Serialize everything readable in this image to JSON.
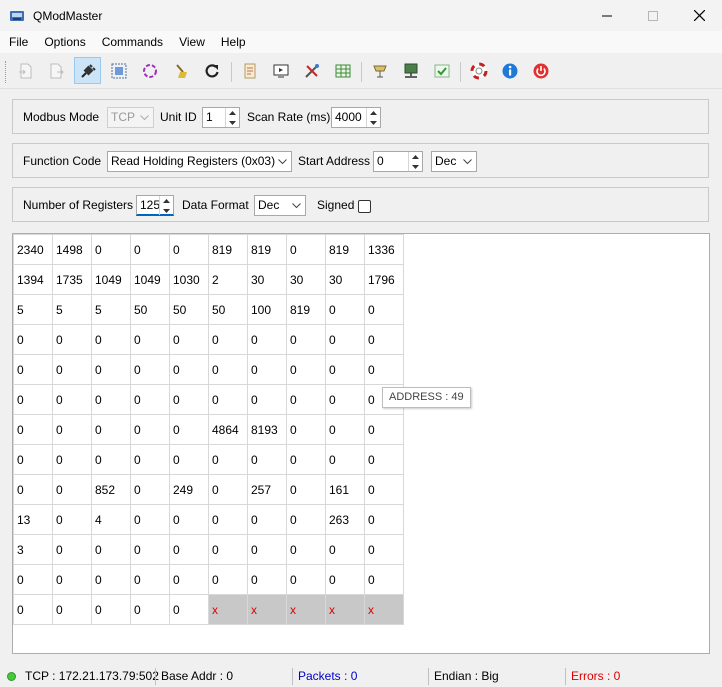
{
  "window": {
    "title": "QModMaster"
  },
  "menu": [
    "File",
    "Options",
    "Commands",
    "View",
    "Help"
  ],
  "toolbar": {
    "icons": [
      "connect-doc-icon",
      "disconnect-doc-icon",
      "plug-connect-icon",
      "bus-monitor-icon",
      "cycle-icon",
      "clear-broom-icon",
      "refresh-icon",
      "log-icon",
      "monitor-icon",
      "tools-icon",
      "table-icon",
      "modbus-rtu-icon",
      "modbus-tcp-icon",
      "checkmark-icon",
      "help-lifebuoy-icon",
      "info-icon",
      "exit-power-icon"
    ]
  },
  "mode_group": {
    "modbus_mode_label": "Modbus Mode",
    "modbus_mode_value": "TCP",
    "unit_id_label": "Unit ID",
    "unit_id_value": "1",
    "scan_rate_label": "Scan Rate (ms)",
    "scan_rate_value": "4000"
  },
  "function_group": {
    "function_code_label": "Function Code",
    "function_code_value": "Read Holding Registers (0x03)",
    "start_address_label": "Start Address",
    "start_address_value": "0",
    "address_format_value": "Dec"
  },
  "format_group": {
    "num_registers_label": "Number of Registers",
    "num_registers_value": "125",
    "data_format_label": "Data Format",
    "data_format_value": "Dec",
    "signed_label": "Signed"
  },
  "registers": [
    [
      "2340",
      "1498",
      "0",
      "0",
      "0",
      "819",
      "819",
      "0",
      "819",
      "1336"
    ],
    [
      "1394",
      "1735",
      "1049",
      "1049",
      "1030",
      "2",
      "30",
      "30",
      "30",
      "1796"
    ],
    [
      "5",
      "5",
      "5",
      "50",
      "50",
      "50",
      "100",
      "819",
      "0",
      "0"
    ],
    [
      "0",
      "0",
      "0",
      "0",
      "0",
      "0",
      "0",
      "0",
      "0",
      "0"
    ],
    [
      "0",
      "0",
      "0",
      "0",
      "0",
      "0",
      "0",
      "0",
      "0",
      "0"
    ],
    [
      "0",
      "0",
      "0",
      "0",
      "0",
      "0",
      "0",
      "0",
      "0",
      "0"
    ],
    [
      "0",
      "0",
      "0",
      "0",
      "0",
      "4864",
      "8193",
      "0",
      "0",
      "0"
    ],
    [
      "0",
      "0",
      "0",
      "0",
      "0",
      "0",
      "0",
      "0",
      "0",
      "0"
    ],
    [
      "0",
      "0",
      "852",
      "0",
      "249",
      "0",
      "257",
      "0",
      "161",
      "0"
    ],
    [
      "13",
      "0",
      "4",
      "0",
      "0",
      "0",
      "0",
      "0",
      "263",
      "0"
    ],
    [
      "3",
      "0",
      "0",
      "0",
      "0",
      "0",
      "0",
      "0",
      "0",
      "0"
    ],
    [
      "0",
      "0",
      "0",
      "0",
      "0",
      "0",
      "0",
      "0",
      "0",
      "0"
    ],
    [
      "0",
      "0",
      "0",
      "0",
      "0",
      "x",
      "x",
      "x",
      "x",
      "x"
    ]
  ],
  "tooltip": "ADDRESS : 49",
  "status": {
    "connection": "TCP : 172.21.173.79:502",
    "base_addr": "Base Addr : 0",
    "packets": "Packets : 0",
    "endian": "Endian : Big",
    "errors": "Errors : 0"
  },
  "colors": {
    "packets": "#0000c8",
    "errors": "#e00000",
    "status_dot": "#47c93b",
    "error_cell_bg": "#c8c8c8"
  }
}
